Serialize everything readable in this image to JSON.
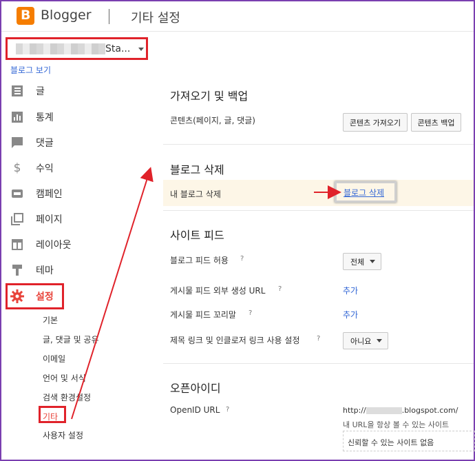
{
  "header": {
    "brand": "Blogger",
    "title": "기타 설정"
  },
  "sidebar": {
    "blog_selector": {
      "name": "Sta..."
    },
    "view_blog": "블로그 보기",
    "items": [
      {
        "label": "글",
        "icon": "posts-icon"
      },
      {
        "label": "통계",
        "icon": "stats-icon"
      },
      {
        "label": "댓글",
        "icon": "comments-icon"
      },
      {
        "label": "수익",
        "icon": "earnings-icon"
      },
      {
        "label": "캠페인",
        "icon": "campaigns-icon"
      },
      {
        "label": "페이지",
        "icon": "pages-icon"
      },
      {
        "label": "레이아웃",
        "icon": "layout-icon"
      },
      {
        "label": "테마",
        "icon": "theme-icon"
      },
      {
        "label": "설정",
        "icon": "gear-icon"
      }
    ],
    "settings_sub": [
      {
        "label": "기본"
      },
      {
        "label": "글, 댓글 및 공유"
      },
      {
        "label": "이메일"
      },
      {
        "label": "언어 및 서식"
      },
      {
        "label": "검색 환경설정"
      },
      {
        "label": "기타"
      },
      {
        "label": "사용자 설정"
      }
    ]
  },
  "main": {
    "import_backup": {
      "title": "가져오기 및 백업",
      "content_label": "콘텐츠(페이지, 글, 댓글)",
      "import_button": "콘텐츠 가져오기",
      "backup_button": "콘텐츠 백업"
    },
    "delete_blog": {
      "title": "블로그 삭제",
      "row_label": "내 블로그 삭제",
      "link": "블로그 삭제"
    },
    "site_feed": {
      "title": "사이트 피드",
      "rows": [
        {
          "label": "블로그 피드 허용",
          "help": "?",
          "value": "전체"
        },
        {
          "label": "게시물 피드 외부 생성 URL",
          "help": "?",
          "value": "추가"
        },
        {
          "label": "게시물 피드 꼬리말",
          "help": "?",
          "value": "추가"
        },
        {
          "label": "제목 링크 및 인클로저 링크 사용 설정",
          "help": "?",
          "value": "아니요"
        }
      ]
    },
    "openid": {
      "title": "오픈아이디",
      "url_label": "OpenID URL",
      "help": "?",
      "url_prefix": "http://",
      "url_suffix": ".blogspot.com/",
      "trust_label": "내 URL을 항상 볼 수 있는 사이트",
      "trust_value": "신뢰할 수 있는 사이트 없음"
    }
  },
  "colors": {
    "accent": "#e8433a",
    "annotation": "#e0222a",
    "link": "#3367d6",
    "brand": "#f57d00"
  }
}
